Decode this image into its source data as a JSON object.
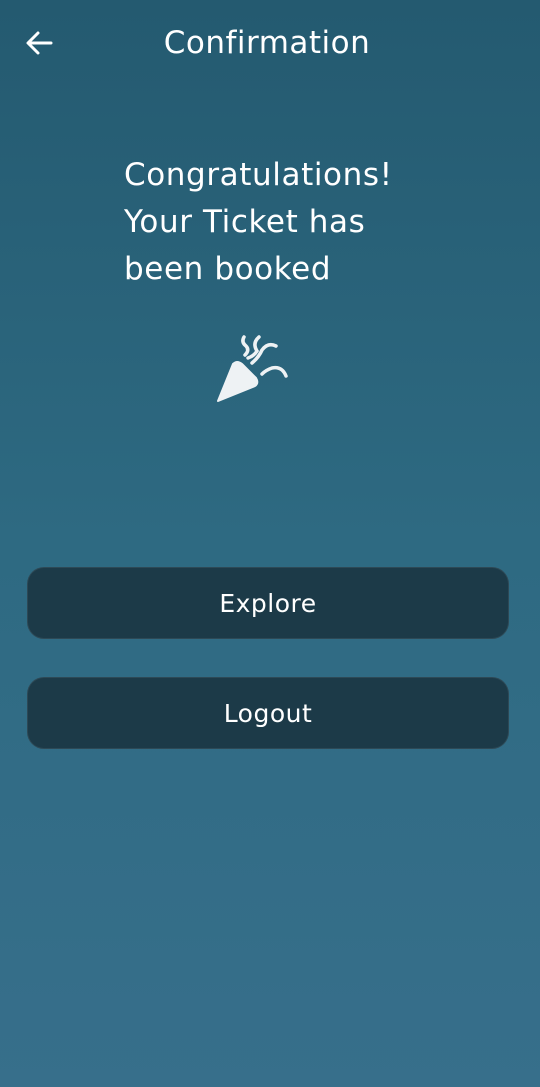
{
  "header": {
    "title": "Confirmation",
    "back_icon": "arrow-left-icon"
  },
  "message": {
    "line1": "Congratulations!",
    "line2": "Your Ticket has",
    "line3": "been booked"
  },
  "celebration": {
    "icon": "party-popper-icon"
  },
  "actions": {
    "explore_label": "Explore",
    "logout_label": "Logout"
  },
  "colors": {
    "background_top": "#245a70",
    "background_bottom": "#376f8b",
    "button_bg": "#1c3a48",
    "text": "#ffffff"
  }
}
